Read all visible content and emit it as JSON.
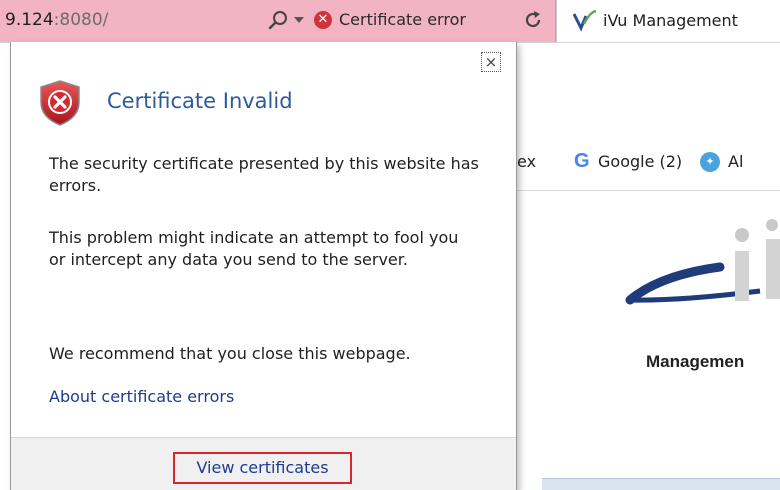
{
  "address_bar": {
    "url_host": "9.124",
    "url_port": ":8080/",
    "security_label": "Certificate error",
    "background_color": "#f2b3c2"
  },
  "tab": {
    "title": "iVu Management"
  },
  "favorites": {
    "partial_item": "/Flex",
    "google_item": "Google (2)",
    "google_glyph": "G",
    "third_item_partial": "Al"
  },
  "page": {
    "heading_partial": "Managemen"
  },
  "popup": {
    "close_glyph": "×",
    "title": "Certificate Invalid",
    "paragraph1": "The security certificate presented by this website has errors.",
    "paragraph2": "This problem might indicate an attempt to fool you or intercept any data you send to the server.",
    "paragraph3": "We recommend that you close this webpage.",
    "about_link": "About certificate errors",
    "view_certificates_button": "View certificates",
    "highlight_color": "#d9262e",
    "title_color": "#2c5a9a",
    "link_color": "#1f3a8f"
  },
  "icons": {
    "search": "search-icon",
    "dropdown": "chevron-down-icon",
    "cert_error": "error-x-icon",
    "refresh": "refresh-icon",
    "shield": "shield-error-icon",
    "close": "close-icon"
  }
}
